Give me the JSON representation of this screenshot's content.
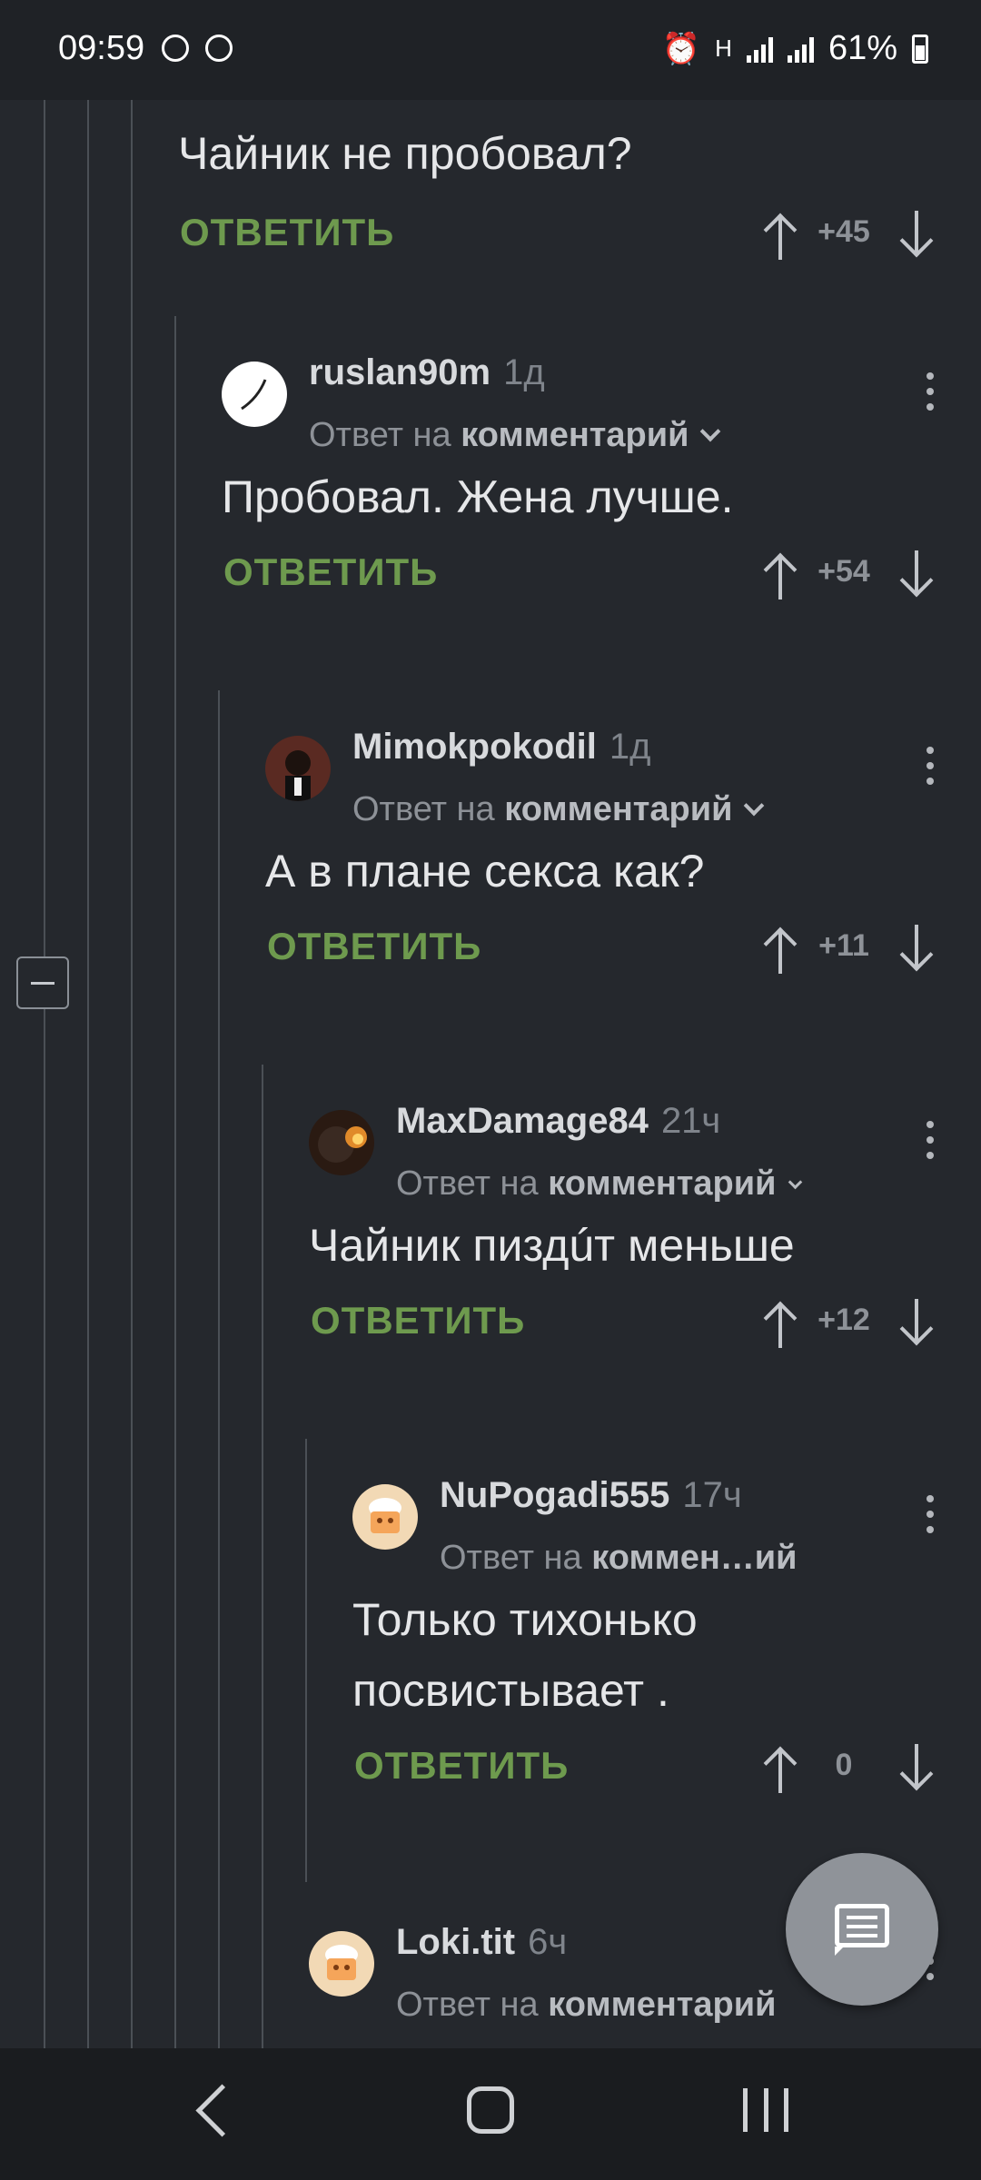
{
  "status_bar": {
    "time": "09:59",
    "battery": "61%",
    "network": "H"
  },
  "thread": {
    "reply_label": "ОТВЕТИТЬ",
    "reply_to_prefix": "Ответ на",
    "collapse_symbol": "−"
  },
  "comments": [
    {
      "text": "Чайник не пробовал?",
      "score": "+45"
    },
    {
      "author": "ruslan90m",
      "time": "1д",
      "reply_target": "комментарий",
      "text": "Пробовал. Жена лучше.",
      "score": "+54",
      "avatar_color": "#ffffff"
    },
    {
      "author": "Mimokpokodil",
      "time": "1д",
      "reply_target": "комментарий",
      "text": "А в плане секса как?",
      "score": "+11",
      "avatar_color": "#5a2a22"
    },
    {
      "author": "MaxDamage84",
      "time": "21ч",
      "reply_target": "комментарий",
      "text": "Чайник пиздúт меньше",
      "score": "+12",
      "avatar_color": "#2a1a12"
    },
    {
      "author": "NuPogadi555",
      "time": "17ч",
      "reply_target": "коммен…ий",
      "text": "Только тихонько посвистывает .",
      "score": "0",
      "avatar_color": "#f2d9b5"
    },
    {
      "author": "Loki.tit",
      "time": "6ч",
      "reply_target": "комментарий",
      "avatar_color": "#f2d9b5"
    }
  ],
  "colors": {
    "background": "#25282d",
    "reply_green": "#6e9a4e",
    "thread_line": "#4b5056"
  },
  "icons": {
    "fab": "comment-icon",
    "nav": [
      "back-icon",
      "home-icon",
      "recents-icon"
    ]
  }
}
